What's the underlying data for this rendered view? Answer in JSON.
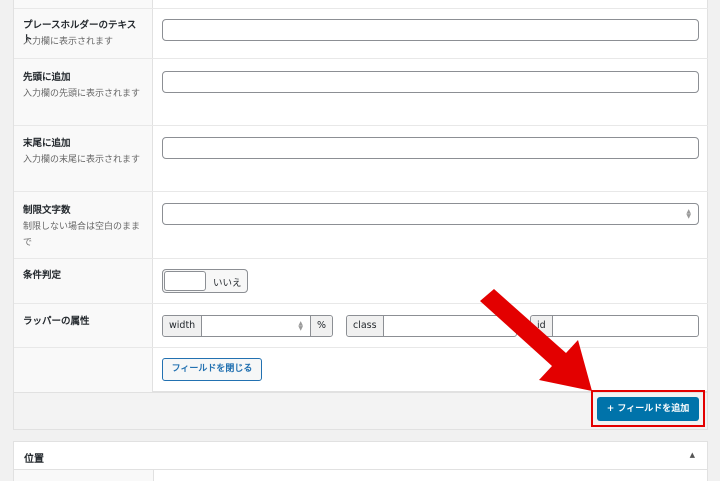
{
  "fields": {
    "placeholder": {
      "label": "プレースホルダーのテキスト",
      "desc": "入力欄に表示されます",
      "value": ""
    },
    "prepend": {
      "label": "先頭に追加",
      "desc": "入力欄の先頭に表示されます",
      "value": ""
    },
    "append": {
      "label": "末尾に追加",
      "desc": "入力欄の末尾に表示されます",
      "value": ""
    },
    "maxlength": {
      "label": "制限文字数",
      "desc": "制限しない場合は空白のままで",
      "value": ""
    },
    "conditional": {
      "label": "条件判定",
      "toggle_text": "いいえ",
      "checked": false
    },
    "wrapper": {
      "label": "ラッパーの属性",
      "width_label": "width",
      "width_value": "",
      "width_unit": "%",
      "class_label": "class",
      "class_value": "",
      "id_label": "id",
      "id_value": ""
    }
  },
  "buttons": {
    "close_field": "フィールドを閉じる",
    "add_field": "+ フィールドを追加"
  },
  "position_section": {
    "title": "位置",
    "toggle_icon": "triangle-up-icon"
  },
  "colors": {
    "primary": "#0073aa",
    "highlight": "#e30000"
  }
}
